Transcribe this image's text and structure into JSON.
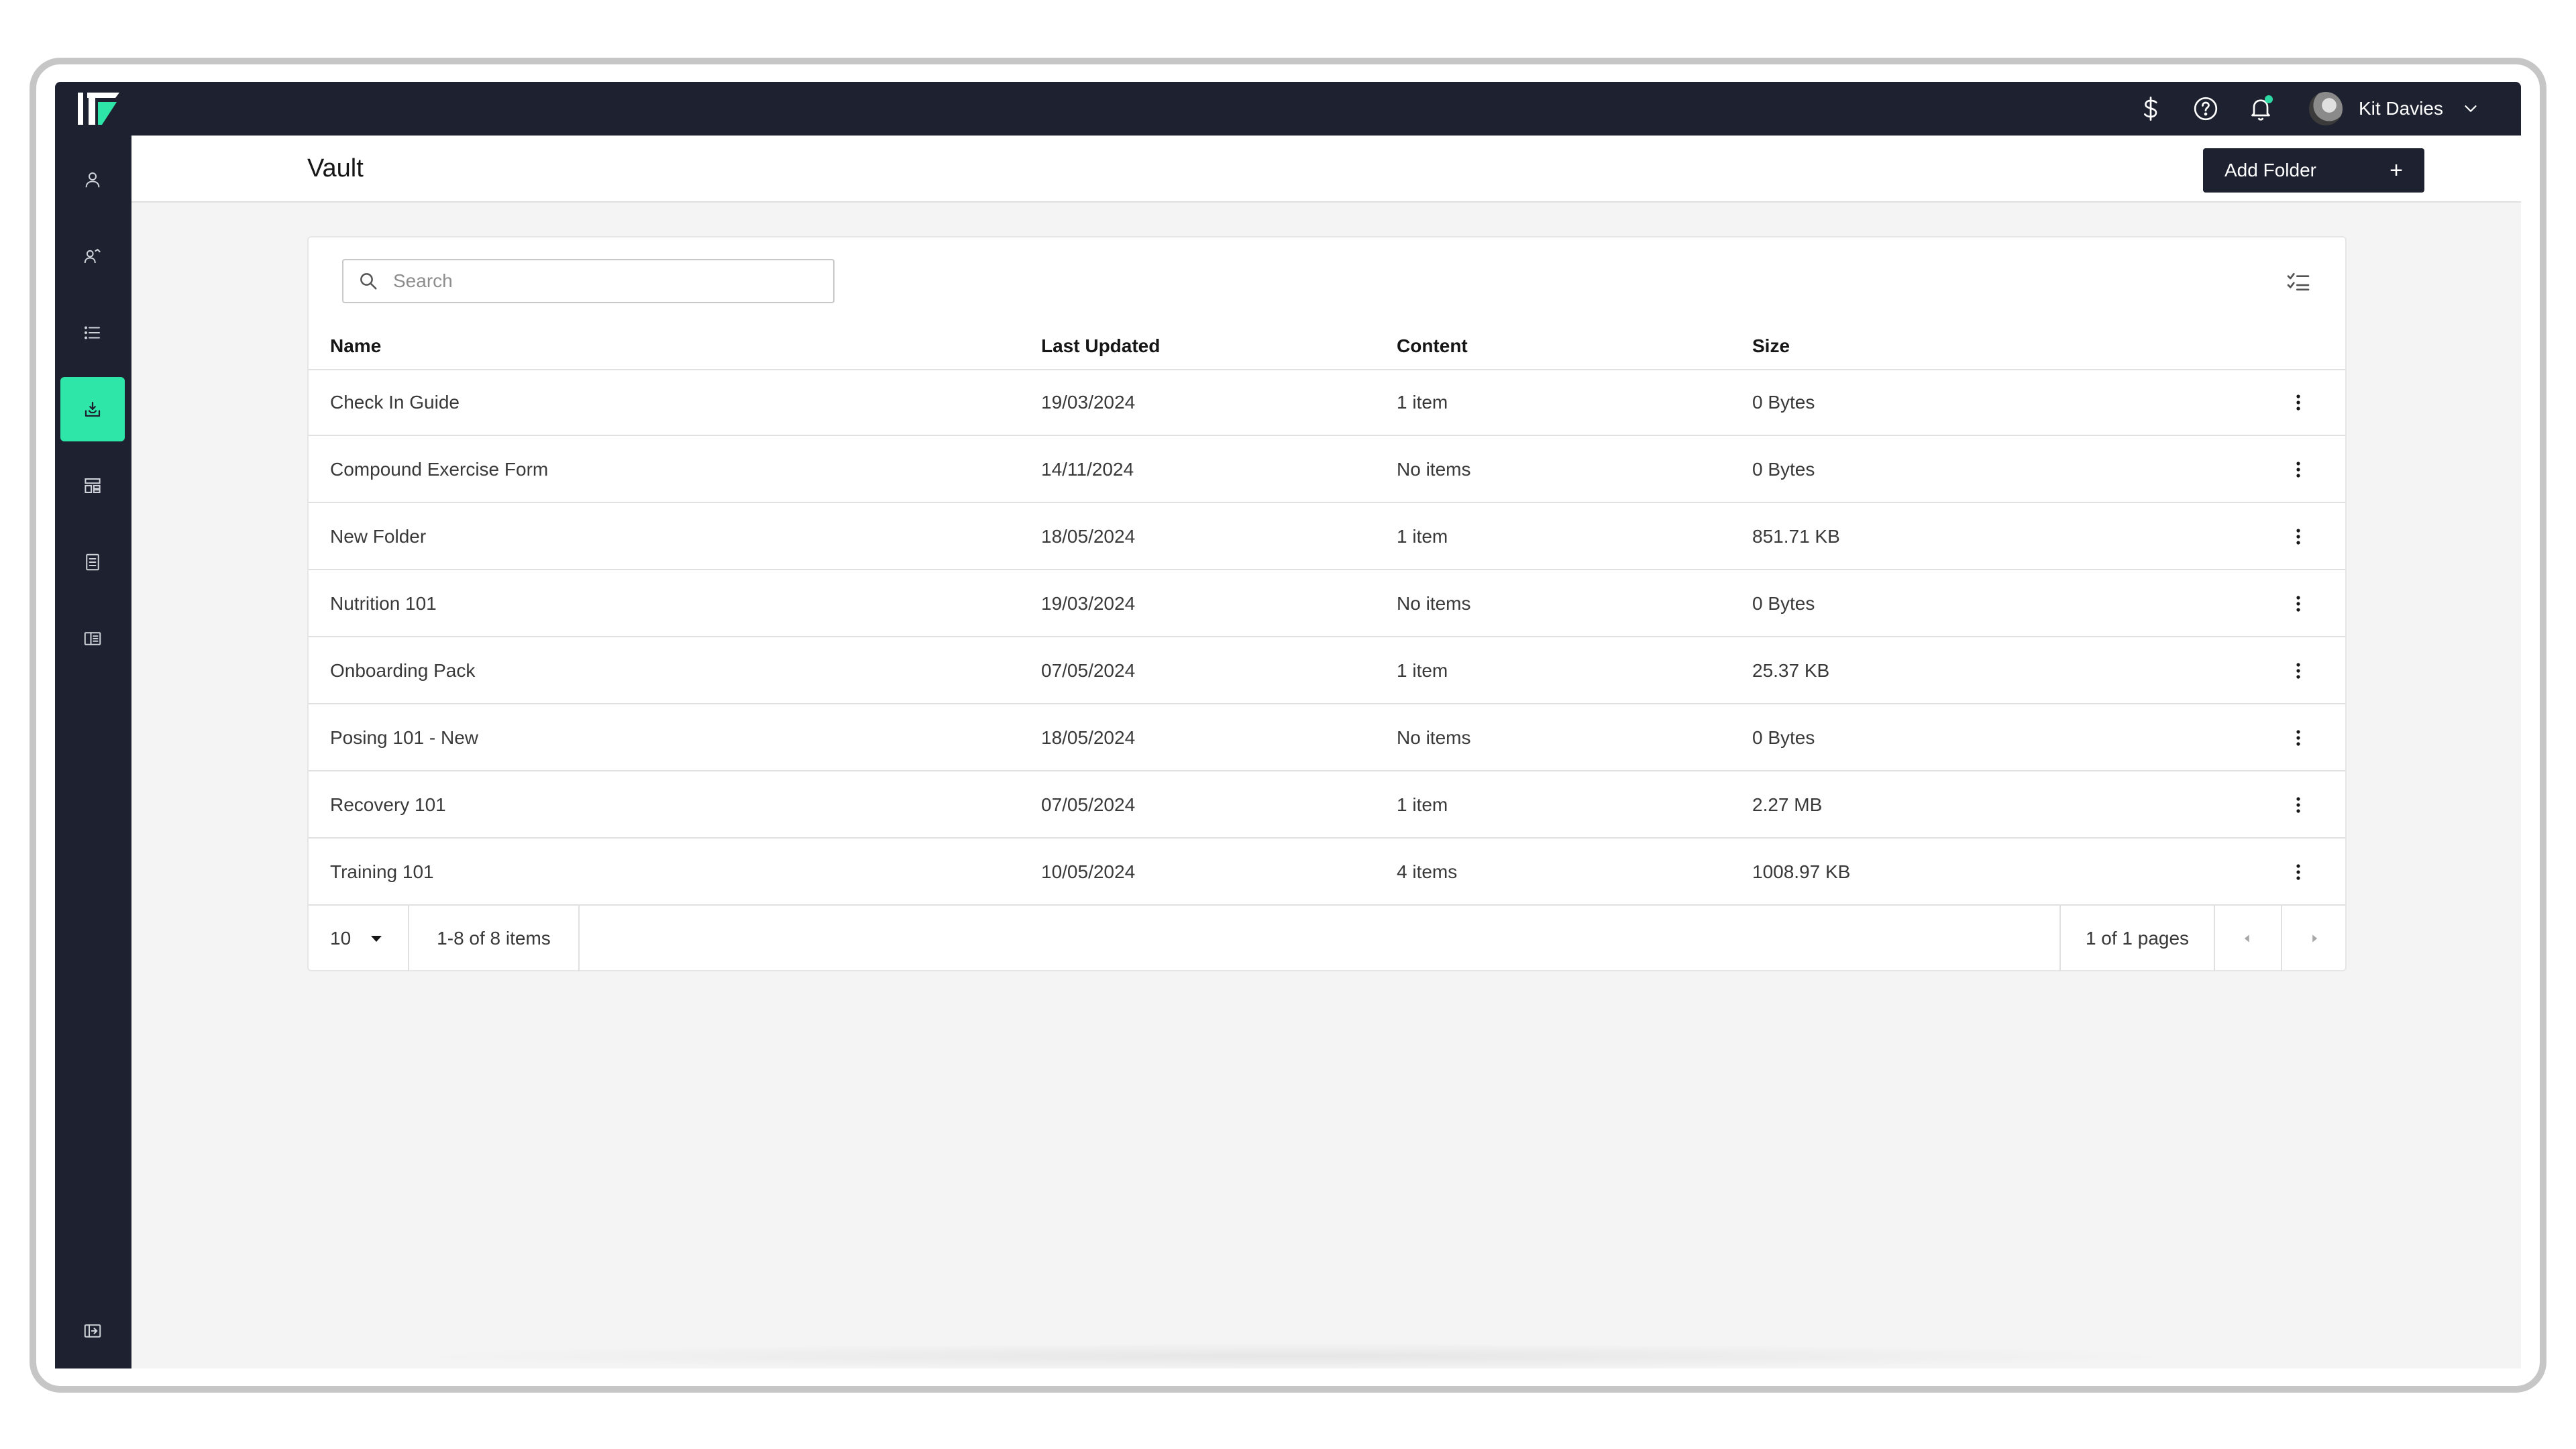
{
  "app": {
    "user_name": "Kit Davies",
    "accent_color": "#2ee6a8",
    "nav_color": "#1e2230"
  },
  "topbar": {
    "icons": [
      "dollar-icon",
      "help-icon",
      "bell-icon"
    ]
  },
  "sidebar": {
    "items": [
      {
        "icon": "user-icon"
      },
      {
        "icon": "clients-icon"
      },
      {
        "icon": "list-icon"
      },
      {
        "icon": "vault-icon",
        "active": true
      },
      {
        "icon": "dashboard-icon"
      },
      {
        "icon": "document-icon"
      },
      {
        "icon": "columns-icon"
      }
    ],
    "footer_icon": "collapse-icon"
  },
  "page": {
    "title": "Vault",
    "add_button_label": "Add Folder",
    "add_button_icon": "+"
  },
  "search": {
    "placeholder": "Search",
    "value": ""
  },
  "table": {
    "columns": [
      "Name",
      "Last Updated",
      "Content",
      "Size"
    ],
    "rows": [
      {
        "name": "Check In Guide",
        "updated": "19/03/2024",
        "content": "1 item",
        "size": "0 Bytes"
      },
      {
        "name": "Compound Exercise Form",
        "updated": "14/11/2024",
        "content": "No items",
        "size": "0 Bytes"
      },
      {
        "name": "New Folder",
        "updated": "18/05/2024",
        "content": "1 item",
        "size": "851.71 KB"
      },
      {
        "name": "Nutrition 101",
        "updated": "19/03/2024",
        "content": "No items",
        "size": "0 Bytes"
      },
      {
        "name": "Onboarding Pack",
        "updated": "07/05/2024",
        "content": "1 item",
        "size": "25.37 KB"
      },
      {
        "name": "Posing 101 - New",
        "updated": "18/05/2024",
        "content": "No items",
        "size": "0 Bytes"
      },
      {
        "name": "Recovery 101",
        "updated": "07/05/2024",
        "content": "1 item",
        "size": "2.27 MB"
      },
      {
        "name": "Training 101",
        "updated": "10/05/2024",
        "content": "4 items",
        "size": "1008.97 KB"
      }
    ]
  },
  "pagination": {
    "page_size": "10",
    "range_text": "1-8 of 8 items",
    "pages_text": "1 of 1 pages"
  }
}
